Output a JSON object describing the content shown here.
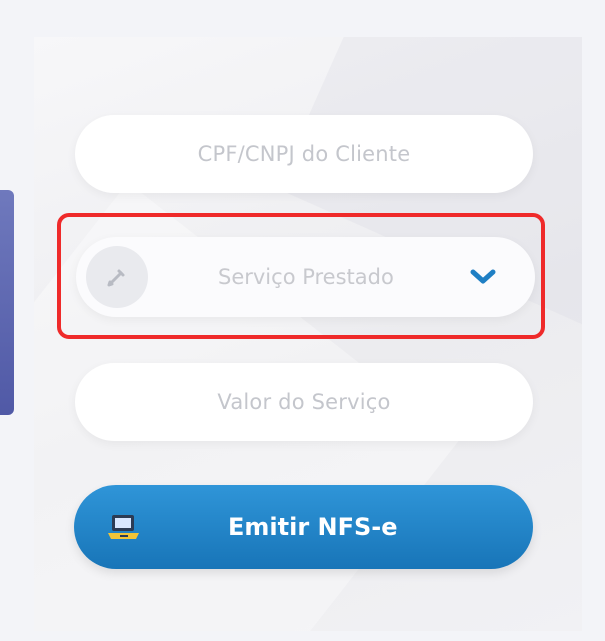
{
  "form": {
    "client_placeholder": "CPF/CNPJ do Cliente",
    "service_placeholder": "Serviço Prestado",
    "value_placeholder": "Valor do Serviço",
    "emit_label": "Emitir NFS-e"
  },
  "icons": {
    "service": "pencil-icon",
    "dropdown": "chevron-down-icon",
    "emit": "laptop-icon"
  },
  "colors": {
    "primary": "#1f7fc4",
    "highlight": "#ef2a2a",
    "card_background": "#f0f0f3"
  }
}
